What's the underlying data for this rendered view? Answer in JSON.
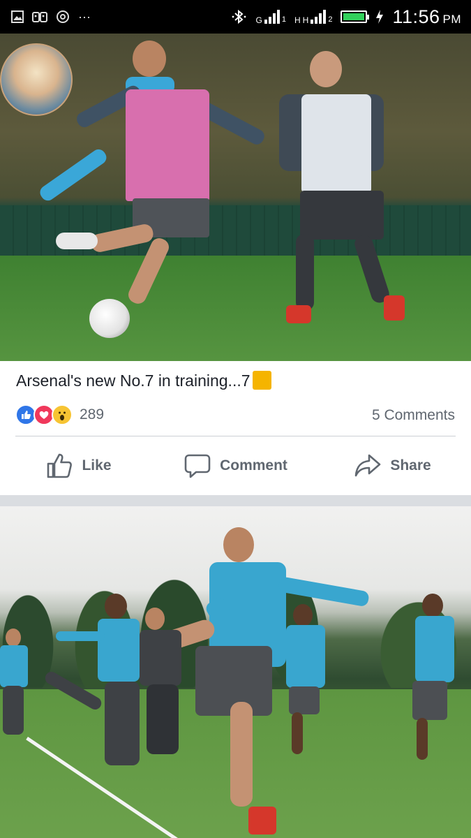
{
  "status_bar": {
    "time": "11:56",
    "ampm": "PM",
    "net1": "G",
    "net2a": "H",
    "net2b": "H",
    "sim1": "1",
    "sim2": "2",
    "battery_level": 1.0,
    "icons": [
      "gallery-icon",
      "robot-icon",
      "sync-icon",
      "more-icon",
      "bluetooth-icon",
      "signal-icon",
      "battery-icon",
      "charging-icon"
    ]
  },
  "post": {
    "caption": "Arsenal's new No.7 in training...7",
    "reaction_count": "289",
    "comments": "5 Comments",
    "reactions": [
      "like",
      "love",
      "wow"
    ],
    "colors": {
      "like": "#2f76e8",
      "love": "#f0385b",
      "wow": "#f7c433",
      "caption_emoji": "#f5b400"
    }
  },
  "actions": {
    "like": "Like",
    "comment": "Comment",
    "share": "Share"
  }
}
